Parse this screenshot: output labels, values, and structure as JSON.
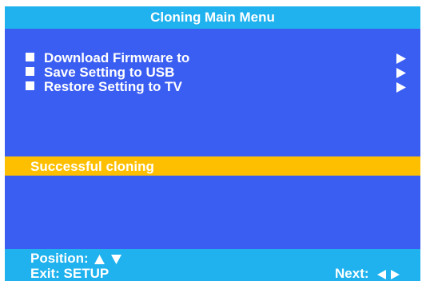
{
  "title": "Cloning Main Menu",
  "menu": {
    "items": [
      {
        "label": "Download Firmware to",
        "bullet_icon": "square-bullet-icon",
        "arrow_icon": "arrow-right-icon"
      },
      {
        "label": "Save Setting to USB",
        "bullet_icon": "square-bullet-icon",
        "arrow_icon": "arrow-right-icon"
      },
      {
        "label": "Restore Setting to TV",
        "bullet_icon": "square-bullet-icon",
        "arrow_icon": "arrow-right-icon"
      }
    ]
  },
  "status": {
    "message": "Successful cloning"
  },
  "footer": {
    "position_label": "Position:",
    "position_icons": [
      "triangle-up-icon",
      "triangle-down-icon"
    ],
    "exit_label": "Exit: SETUP",
    "next_label": "Next:",
    "next_icons": [
      "triangle-left-icon",
      "triangle-right-icon"
    ]
  },
  "colors": {
    "title_bar": "#1fb2ee",
    "menu_panel": "#3b5ef2",
    "status_highlight": "#fdbf00",
    "text": "#ffffff"
  }
}
